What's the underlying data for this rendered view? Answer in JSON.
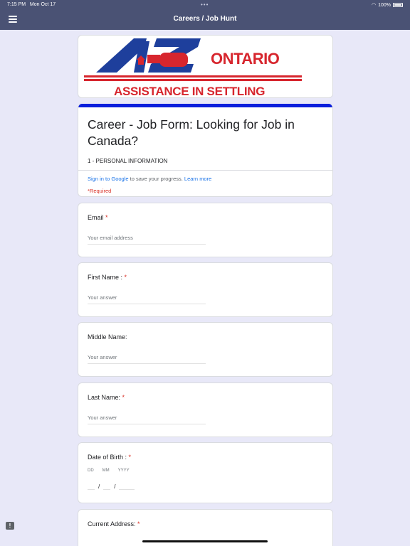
{
  "status": {
    "time": "7:15 PM",
    "date": "Mon Oct 17",
    "battery": "100%",
    "dots": "•••"
  },
  "appbar": {
    "title": "Careers / Job Hunt",
    "menu_icon": "hamburger-icon"
  },
  "banner": {
    "brand_top": "ONTARIO",
    "brand_bottom": "ASSISTANCE IN SETTLING",
    "logo_letters": "AZ"
  },
  "form": {
    "title": "Career - Job Form: Looking for Job in Canada?",
    "description": "1 - PERSONAL INFORMATION",
    "signin_link": "Sign in to Google",
    "signin_rest": " to save your progress. ",
    "learn_more": "Learn more",
    "required_note": "*Required"
  },
  "questions": [
    {
      "label": "Email",
      "required": "*",
      "placeholder": "Your email address"
    },
    {
      "label": "First Name :",
      "required": "*",
      "placeholder": "Your answer"
    },
    {
      "label": "Middle Name:",
      "required": "",
      "placeholder": "Your answer"
    },
    {
      "label": "Last Name:",
      "required": "*",
      "placeholder": "Your answer"
    }
  ],
  "dob": {
    "label": "Date of Birth :",
    "required": "*",
    "dd": "DD",
    "mm": "MM",
    "yyyy": "YYYY",
    "sep": "/"
  },
  "address": {
    "label": "Current Address:",
    "required": "*"
  },
  "colors": {
    "appbar": "#4a5274",
    "background": "#e8e8f8",
    "accent": "#0a1fdc",
    "required": "#d93025",
    "link": "#1a73e8"
  }
}
